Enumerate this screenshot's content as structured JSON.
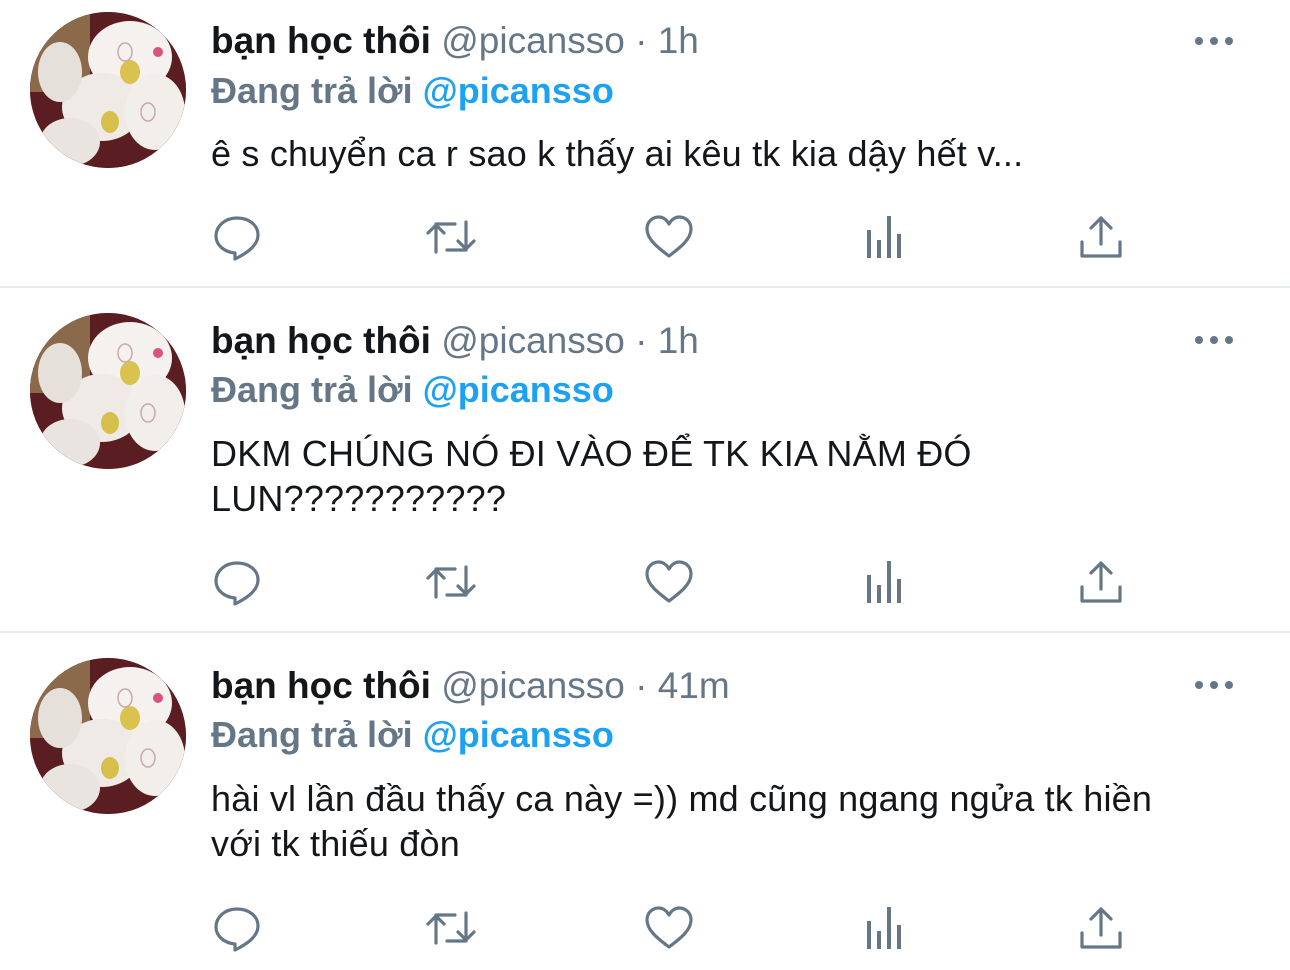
{
  "tweets": [
    {
      "display_name": "bạn học thôi",
      "handle": "@picansso",
      "separator": "·",
      "time": "1h",
      "replying_label": "Đang trả lời",
      "replying_to": "@picansso",
      "text": "ê s chuyển ca r sao k thấy ai kêu tk kia dậy hết v..."
    },
    {
      "display_name": "bạn học thôi",
      "handle": "@picansso",
      "separator": "·",
      "time": "1h",
      "replying_label": "Đang trả lời",
      "replying_to": "@picansso",
      "text": "DKM CHÚNG NÓ ĐI VÀO ĐỂ TK KIA NẰM ĐÓ LUN???????????"
    },
    {
      "display_name": "bạn học thôi",
      "handle": "@picansso",
      "separator": "·",
      "time": "41m",
      "replying_label": "Đang trả lời",
      "replying_to": "@picansso",
      "text": "hài vl lần đầu thấy ca này =)) md cũng ngang ngửa tk hiền với tk thiếu đòn"
    }
  ],
  "icons": {
    "reply": "comment-bubble-icon",
    "retweet": "retweet-arrows-icon",
    "like": "heart-outline-icon",
    "analytics": "bar-chart-icon",
    "share": "share-upload-icon",
    "more": "three-dots-icon"
  },
  "colors": {
    "text_primary": "#14171a",
    "text_secondary": "#657786",
    "accent": "#1da1f2",
    "divider": "#e6ecf0",
    "icon": "#657786"
  }
}
